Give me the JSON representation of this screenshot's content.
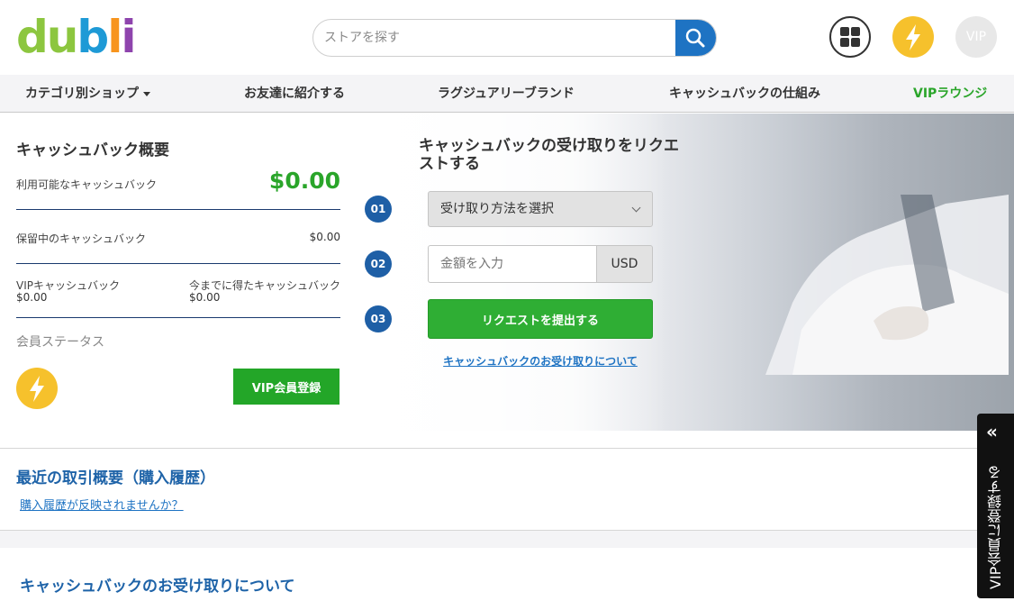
{
  "header": {
    "logo_letters": [
      {
        "char": "d",
        "color": "#8cc63f"
      },
      {
        "char": "u",
        "color": "#8cc63f"
      },
      {
        "char": "b",
        "color": "#1e9ad6"
      },
      {
        "char": "l",
        "color": "#f7941d"
      },
      {
        "char": "i",
        "color": "#8e44ad"
      }
    ],
    "search_placeholder": "ストアを探す",
    "vip_badge": "VIP",
    "icons": [
      "search-icon",
      "grid-icon",
      "lightning-icon",
      "vip-icon"
    ]
  },
  "nav": {
    "items": [
      {
        "label": "カテゴリ別ショップ"
      },
      {
        "label": "お友達に紹介する"
      },
      {
        "label": "ラグジュアリーブランド"
      },
      {
        "label": "キャッシュバックの仕組み"
      },
      {
        "label": "VIPラウンジ"
      }
    ],
    "vip_color": "#2aa52a"
  },
  "summary": {
    "title": "キャッシュバック概要",
    "available_label": "利用可能なキャッシュバック",
    "available_value": "$0.00",
    "pending_label": "保留中のキャッシュバック",
    "pending_value": "$0.00",
    "vip_label": "VIPキャッシュバック",
    "vip_value": "$0.00",
    "total_label": "今までに得たキャッシュバック",
    "total_value": "$0.00",
    "status_label": "会員ステータス",
    "vip_button": "VIP会員登録"
  },
  "request": {
    "title": "キャッシュバックの受け取りをリクエストする",
    "steps": [
      "01",
      "02",
      "03"
    ],
    "method_placeholder": "受け取り方法を選択",
    "amount_placeholder": "金額を入力",
    "currency": "USD",
    "submit_label": "リクエストを提出する",
    "about_link": "キャッシュバックのお受け取りについて"
  },
  "recent": {
    "title": "最近の取引概要（購入履歴）",
    "link": "購入履歴が反映されませんか？"
  },
  "bottom": {
    "title": "キャッシュバックのお受け取りについて"
  },
  "sidetab": {
    "chevron": "«",
    "label": "VIP会員に登録する"
  },
  "colors": {
    "accent_blue": "#1e73c3",
    "green": "#2aa52a",
    "yellow": "#f6c12c"
  }
}
